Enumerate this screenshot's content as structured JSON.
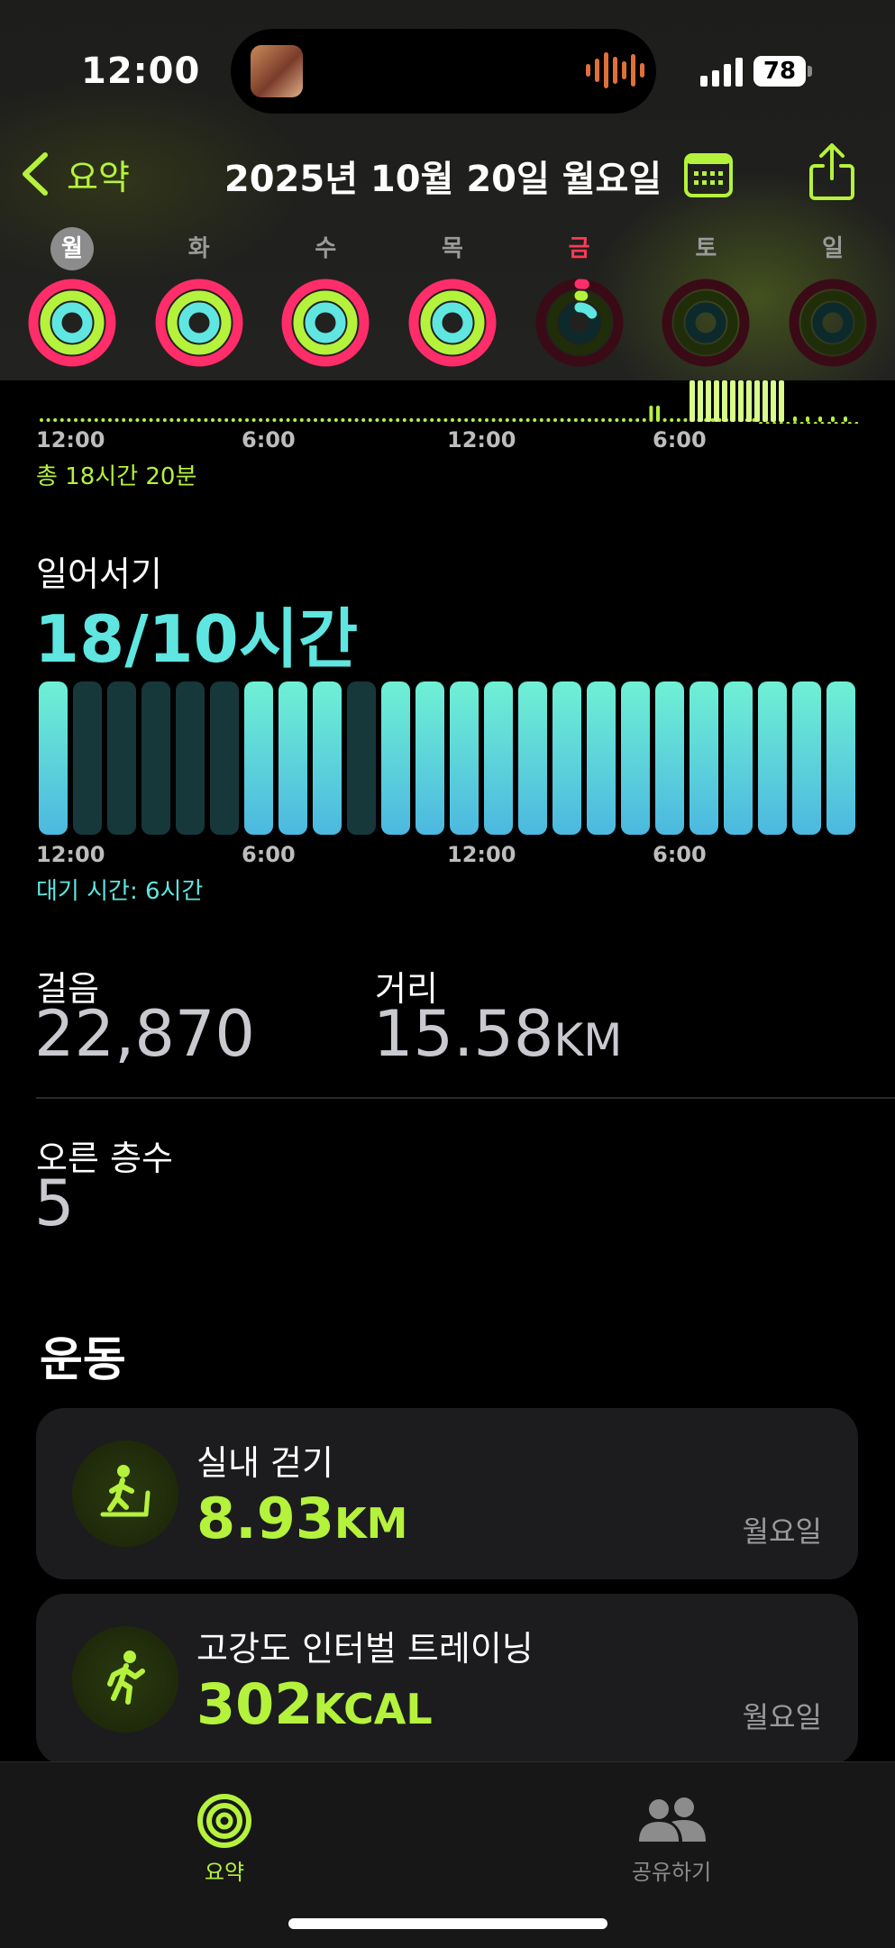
{
  "status_bar": {
    "time": "12:00",
    "battery": "78"
  },
  "nav": {
    "back_label": "요약",
    "title": "2025년 10월 20일 월요일"
  },
  "week": [
    {
      "label": "월",
      "selected": true,
      "today": false,
      "move": 1.0,
      "exercise": 1.0,
      "stand": 1.0
    },
    {
      "label": "화",
      "selected": false,
      "today": false,
      "move": 1.0,
      "exercise": 1.0,
      "stand": 1.0
    },
    {
      "label": "수",
      "selected": false,
      "today": false,
      "move": 1.0,
      "exercise": 1.0,
      "stand": 1.0
    },
    {
      "label": "목",
      "selected": false,
      "today": false,
      "move": 1.0,
      "exercise": 1.0,
      "stand": 1.0
    },
    {
      "label": "금",
      "selected": false,
      "today": true,
      "move": 0.02,
      "exercise": 0.02,
      "stand": 0.15
    },
    {
      "label": "토",
      "selected": false,
      "today": false,
      "move": 0,
      "exercise": 0,
      "stand": 0
    },
    {
      "label": "일",
      "selected": false,
      "today": false,
      "move": 0,
      "exercise": 0,
      "stand": 0
    }
  ],
  "exercise_minutes": {
    "axis": [
      "12:00",
      "6:00",
      "12:00",
      "6:00"
    ],
    "total": "총 18시간 20분"
  },
  "stand": {
    "title": "일어서기",
    "value": "18/10시간",
    "axis": [
      "12:00",
      "6:00",
      "12:00",
      "6:00"
    ],
    "idle": "대기 시간: 6시간",
    "hours": [
      1,
      0,
      0,
      0,
      0,
      0,
      1,
      1,
      1,
      0,
      1,
      1,
      1,
      1,
      1,
      1,
      1,
      1,
      1,
      1,
      1,
      1,
      1,
      1
    ]
  },
  "steps": {
    "label": "걸음",
    "value": "22,870"
  },
  "distance": {
    "label": "거리",
    "value": "15.58",
    "unit": "KM"
  },
  "floors": {
    "label": "오른 층수",
    "value": "5"
  },
  "workouts": {
    "title": "운동",
    "items": [
      {
        "name": "실내 걷기",
        "value": "8.93",
        "unit": "KM",
        "day": "월요일",
        "icon": "indoor-walk-icon"
      },
      {
        "name": "고강도 인터벌 트레이닝",
        "value": "302",
        "unit": "KCAL",
        "day": "월요일",
        "icon": "hiit-icon"
      }
    ]
  },
  "tabs": [
    {
      "label": "요약",
      "icon": "activity-rings-icon",
      "active": true
    },
    {
      "label": "공유하기",
      "icon": "people-icon",
      "active": false
    }
  ],
  "colors": {
    "accent": "#b5f23c",
    "move": "#ff2d6a",
    "exercise": "#b5f23c",
    "stand": "#5fe6e0"
  }
}
